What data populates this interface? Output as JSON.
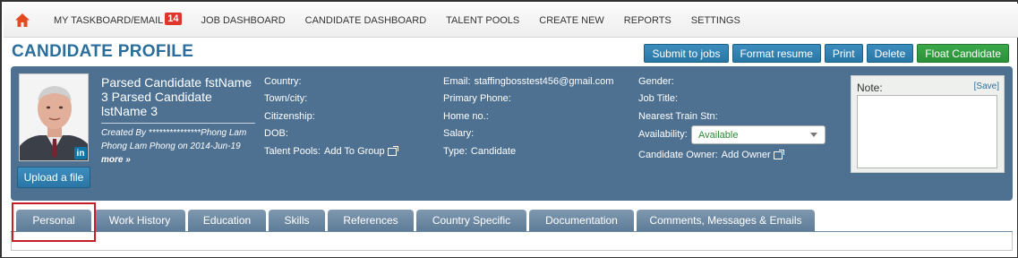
{
  "nav": {
    "items": [
      {
        "label": "MY TASKBOARD/EMAIL",
        "badge": "14"
      },
      {
        "label": "JOB DASHBOARD"
      },
      {
        "label": "CANDIDATE DASHBOARD"
      },
      {
        "label": "TALENT POOLS"
      },
      {
        "label": "CREATE NEW"
      },
      {
        "label": "REPORTS"
      },
      {
        "label": "SETTINGS"
      }
    ],
    "home_icon": "home-icon",
    "home_color": "#e24a22"
  },
  "page": {
    "title": "CANDIDATE PROFILE"
  },
  "actions": {
    "submit": "Submit to jobs",
    "format": "Format resume",
    "print": "Print",
    "delete": "Delete",
    "float": "Float Candidate"
  },
  "profile": {
    "name": "Parsed Candidate fstName 3 Parsed Candidate lstName 3",
    "created_by": "Created By ***************Phong Lam Phong Lam Phong on 2014-Jun-19",
    "more": "more »",
    "upload": "Upload a file",
    "linkedin": "in"
  },
  "fields": {
    "country": "Country:",
    "town": "Town/city:",
    "citizenship": "Citizenship:",
    "dob": "DOB:",
    "talent_pools": "Talent Pools:",
    "add_to_group": "Add To Group",
    "email": "Email:",
    "email_value": "staffingbosstest456@gmail.com",
    "primary_phone": "Primary Phone:",
    "home_no": "Home no.:",
    "salary": "Salary:",
    "type": "Type:",
    "type_value": "Candidate",
    "gender": "Gender:",
    "job_title": "Job Title:",
    "nearest_train": "Nearest Train Stn:",
    "availability": "Availability:",
    "availability_value": "Available",
    "candidate_owner": "Candidate Owner:",
    "add_owner": "Add Owner"
  },
  "note": {
    "label": "Note:",
    "save": "[Save]"
  },
  "tabs": [
    "Personal",
    "Work History",
    "Education",
    "Skills",
    "References",
    "Country Specific",
    "Documentation",
    "Comments, Messages & Emails"
  ],
  "colors": {
    "panel": "#4e7192",
    "title": "#2b6e9b",
    "badge": "#e0352b",
    "float_button": "#2c9139",
    "available_text": "#2e8b3a"
  }
}
